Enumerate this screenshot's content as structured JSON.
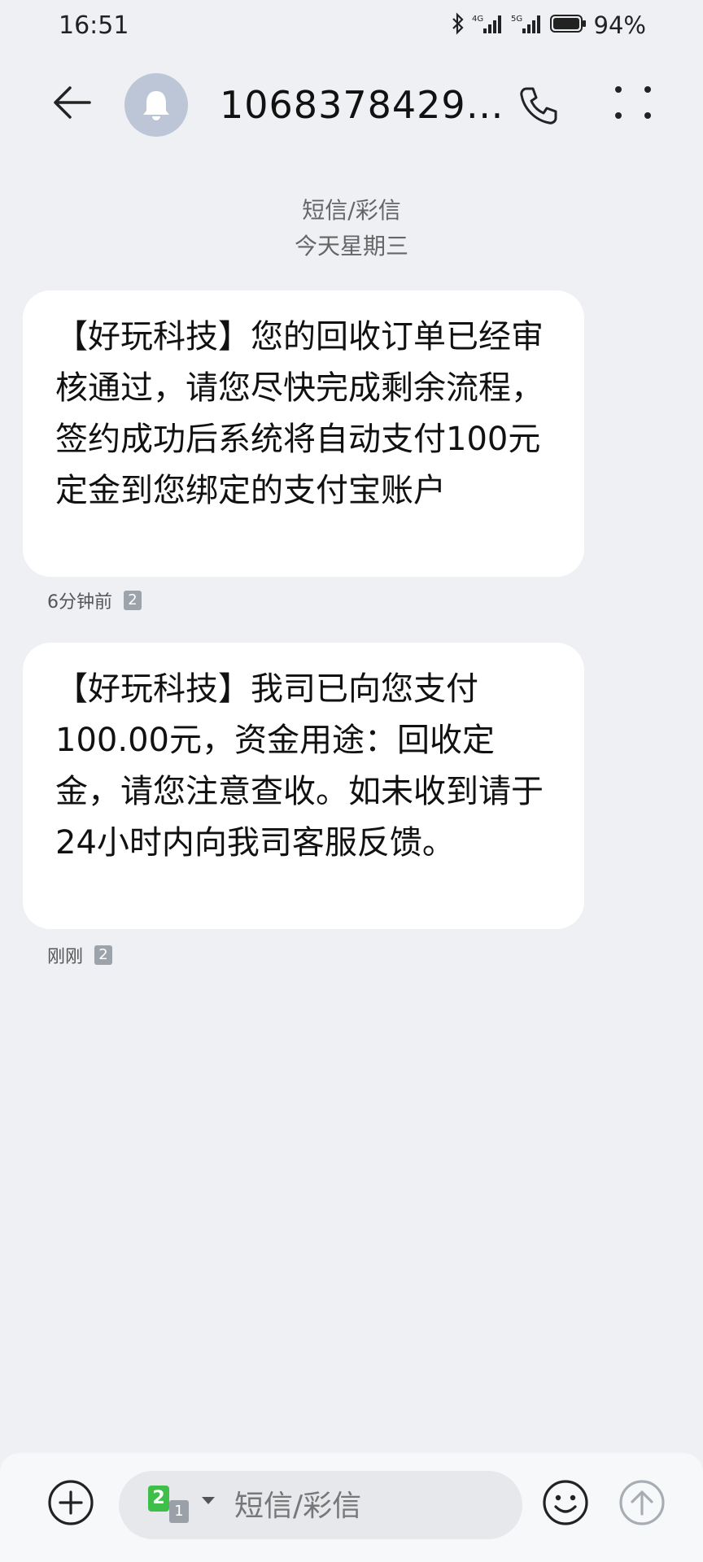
{
  "status_bar": {
    "time": "16:51",
    "network_1": "4G",
    "network_2": "5G",
    "battery": "94%"
  },
  "header": {
    "contact": "1068378429…",
    "avatar_icon": "bell-icon"
  },
  "thread": {
    "channel": "短信/彩信",
    "date": "今天星期三"
  },
  "messages": [
    {
      "text": "【好玩科技】您的回收订单已经审核通过，请您尽快完成剩余流程，签约成功后系统将自动支付100元定金到您绑定的支付宝账户",
      "time": "6分钟前",
      "sim": "2"
    },
    {
      "text": "【好玩科技】我司已向您支付100.00元，资金用途：回收定金，请您注意查收。如未收到请于24小时内向我司客服反馈。",
      "time": "刚刚",
      "sim": "2"
    }
  ],
  "composer": {
    "placeholder": "短信/彩信",
    "sim_primary": "2",
    "sim_secondary": "1"
  },
  "colors": {
    "background": "#eef0f4",
    "bubble": "#ffffff",
    "sim_green": "#3fbf4a"
  }
}
